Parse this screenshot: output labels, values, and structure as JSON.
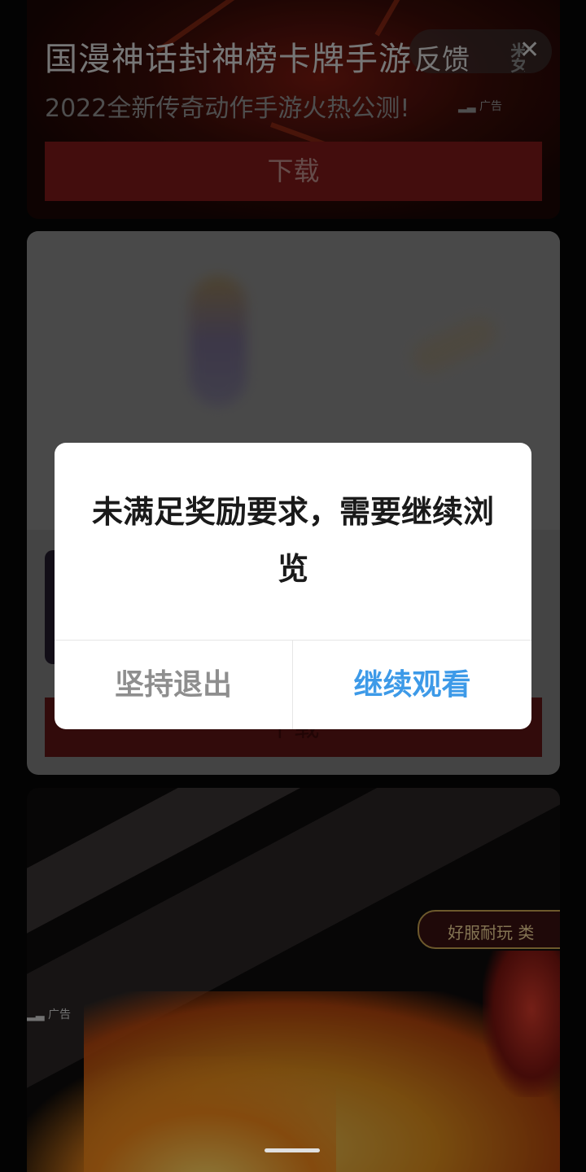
{
  "ad_card_1": {
    "title": "国漫神话封神榜卡牌手游",
    "title_tail": "数集",
    "feedback_label": "反馈",
    "subtitle": "2022全新传奇动作手游火热公测!",
    "ad_label": "广告",
    "download_label": "下载"
  },
  "ad_card_2": {
    "download_label": "下载"
  },
  "ad_card_3": {
    "banner_text": "好服耐玩",
    "banner_tail": "类",
    "ad_label": "广告"
  },
  "dialog": {
    "message": "未满足奖励要求，需要继续浏览",
    "quit_label": "坚持退出",
    "continue_label": "继续观看"
  },
  "colors": {
    "accent_blue": "#3d9ae8",
    "download_red": "#7a1818"
  },
  "icons": [
    "close-icon",
    "ad-signal-icon"
  ]
}
